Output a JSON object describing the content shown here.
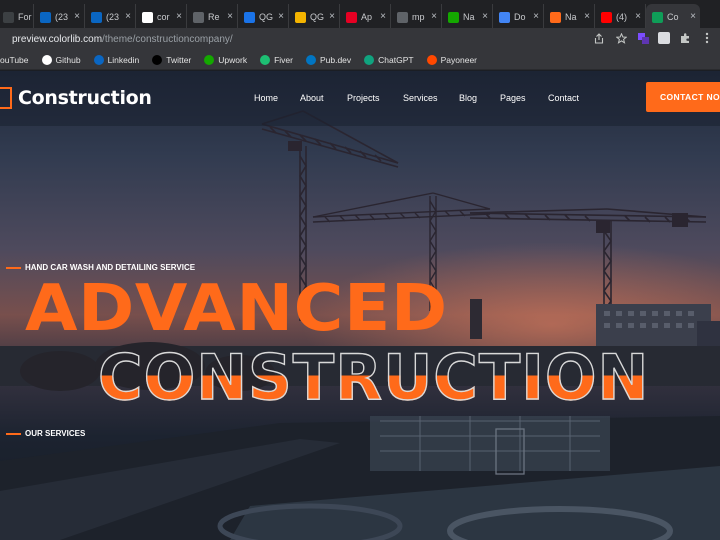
{
  "browser": {
    "tabs": [
      {
        "title": "For",
        "icon": "document-icon",
        "color": "#3c4043"
      },
      {
        "title": "(23",
        "icon": "linkedin-icon",
        "color": "#0a66c2"
      },
      {
        "title": "(23",
        "icon": "linkedin-icon",
        "color": "#0a66c2"
      },
      {
        "title": "cor",
        "icon": "google-icon",
        "color": "#ffffff"
      },
      {
        "title": "Re",
        "icon": "globe-icon",
        "color": "#5f6368"
      },
      {
        "title": "QG",
        "icon": "triangle-icon",
        "color": "#1a73e8"
      },
      {
        "title": "QG",
        "icon": "hand-icon",
        "color": "#f4b400"
      },
      {
        "title": "Ap",
        "icon": "pinterest-icon",
        "color": "#e60023"
      },
      {
        "title": "mp",
        "icon": "globe-icon",
        "color": "#5f6368"
      },
      {
        "title": "Na",
        "icon": "upwork-icon",
        "color": "#14a800"
      },
      {
        "title": "Do",
        "icon": "diamond-icon",
        "color": "#4285f4"
      },
      {
        "title": "Na",
        "icon": "colorlib-icon",
        "color": "#ff6a1a"
      },
      {
        "title": "(4)",
        "icon": "youtube-icon",
        "color": "#ff0000"
      },
      {
        "title": "Co",
        "icon": "check-icon",
        "color": "#0f9d58"
      }
    ],
    "url_host": "preview.colorlib.com",
    "url_path": "/theme/constructioncompany/",
    "bookmarks": [
      {
        "label": "ouTube",
        "icon": "youtube-icon",
        "color": "#ff0000"
      },
      {
        "label": "Github",
        "icon": "github-icon",
        "color": "#ffffff"
      },
      {
        "label": "Linkedin",
        "icon": "linkedin-icon",
        "color": "#0a66c2"
      },
      {
        "label": "Twitter",
        "icon": "x-icon",
        "color": "#000000"
      },
      {
        "label": "Upwork",
        "icon": "upwork-icon",
        "color": "#14a800"
      },
      {
        "label": "Fiver",
        "icon": "fiverr-icon",
        "color": "#1dbf73"
      },
      {
        "label": "Pub.dev",
        "icon": "dart-icon",
        "color": "#0175c2"
      },
      {
        "label": "ChatGPT",
        "icon": "chatgpt-icon",
        "color": "#10a37f"
      },
      {
        "label": "Payoneer",
        "icon": "payoneer-icon",
        "color": "#ff4800"
      }
    ]
  },
  "site": {
    "logo": "Construction",
    "nav": [
      "Home",
      "About",
      "Projects",
      "Services",
      "Blog",
      "Pages",
      "Contact"
    ],
    "cta": "CONTACT NOW",
    "tagline": "HAND CAR WASH AND DETAILING SERVICE",
    "headline_1": "ADVANCED",
    "headline_2": "CONSTRUCTION",
    "services_label": "OUR SERVICES",
    "accent_color": "#ff6a1a"
  }
}
